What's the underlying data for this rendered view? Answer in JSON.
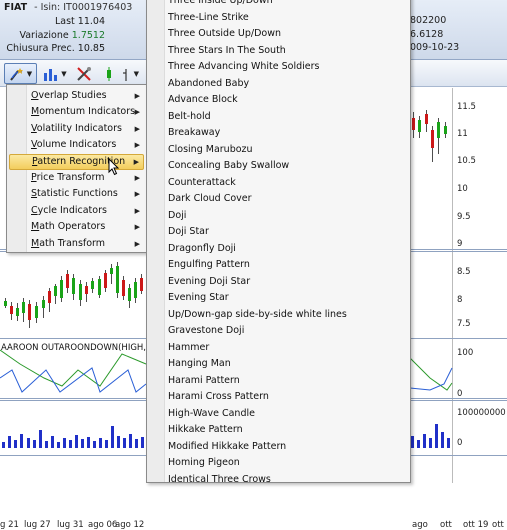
{
  "header": {
    "symbol": "FIAT",
    "isin": "- Isin: IT0001976403",
    "last": "Last 11.04",
    "variation_label": "Variazione",
    "variation_value": "1.7512",
    "close_prev": "Chiusura Prec.  10.85",
    "right_values": [
      "802200",
      "6.6128",
      "009-10-23"
    ]
  },
  "toolbar": {
    "icons": [
      "indicator-wand-icon",
      "bar-chart-icon",
      "tools-icon",
      "candle-type-icon",
      "line-tool-icon"
    ]
  },
  "chart": {
    "indicator_label": "AAROON OUTAROONDOWN(HIGH,LOW,A",
    "price_axis": [
      "11.5",
      "11",
      "10.5",
      "10",
      "9.5",
      "9",
      "8.5",
      "8",
      "7.5"
    ],
    "aroon_axis": [
      "100",
      "0"
    ],
    "volume_axis": [
      "100000000",
      "0"
    ],
    "x_labels": [
      "g 21",
      "lug 27",
      "lug 31",
      "ago 06",
      "ago 12",
      "ago",
      "ott",
      "ott 19",
      "ott 2"
    ]
  },
  "menu_level1": {
    "items": [
      {
        "label": "Overlap Studies",
        "u": "O"
      },
      {
        "label": "Momentum Indicators",
        "u": "M"
      },
      {
        "label": "Volatility Indicators",
        "u": "V"
      },
      {
        "label": "Volume Indicators",
        "u": "V"
      },
      {
        "label": "Pattern Recognition",
        "u": "P",
        "highlighted": true
      },
      {
        "label": "Price Transform",
        "u": "P"
      },
      {
        "label": "Statistic Functions",
        "u": "S"
      },
      {
        "label": "Cycle Indicators",
        "u": "C"
      },
      {
        "label": "Math Operators",
        "u": "M"
      },
      {
        "label": "Math Transform",
        "u": "M"
      }
    ]
  },
  "menu_level2": {
    "items": [
      "Three Inside Up/Down",
      "Three-Line Strike",
      "Three Outside Up/Down",
      "Three Stars In The South",
      "Three Advancing White Soldiers",
      "Abandoned Baby",
      "Advance Block",
      "Belt-hold",
      "Breakaway",
      "Closing Marubozu",
      "Concealing Baby Swallow",
      "Counterattack",
      "Dark Cloud Cover",
      "Doji",
      "Doji Star",
      "Dragonfly Doji",
      "Engulfing Pattern",
      "Evening Doji Star",
      "Evening Star",
      "Up/Down-gap side-by-side white lines",
      "Gravestone Doji",
      "Hammer",
      "Hanging Man",
      "Harami Pattern",
      "Harami Cross Pattern",
      "High-Wave Candle",
      "Hikkake Pattern",
      "Modified Hikkake Pattern",
      "Homing Pigeon",
      "Identical Three Crows"
    ]
  },
  "colors": {
    "candle_up": "#1aa318",
    "candle_down": "#cc1818",
    "aroon_up": "#2c9a2c",
    "aroon_down": "#2a5fd6",
    "volume": "#2030c8",
    "menu_highlight": "#f6d46b"
  }
}
